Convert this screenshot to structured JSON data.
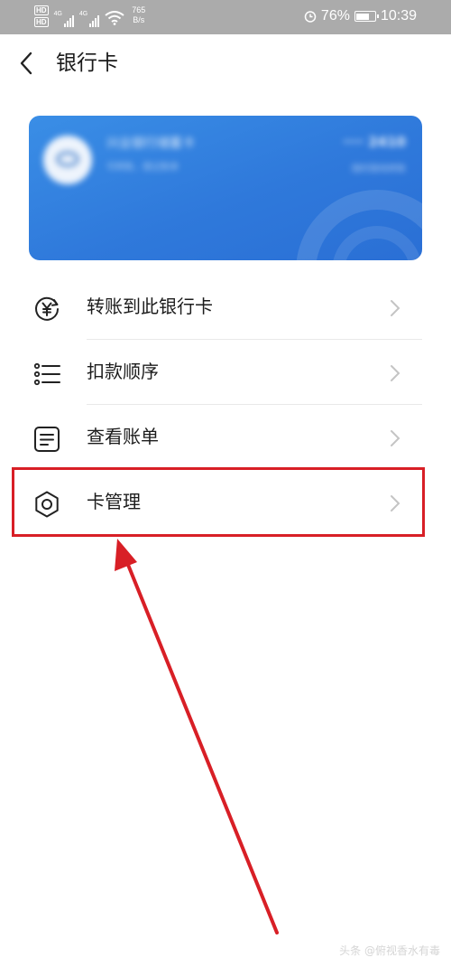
{
  "status_bar": {
    "hd1": "HD",
    "hd2": "HD",
    "net1": "4G",
    "net2": "4G",
    "speed_value": "765",
    "speed_unit": "B/s",
    "battery": "76%",
    "battery_level": 0.76,
    "time": "10:39"
  },
  "header": {
    "title": "银行卡"
  },
  "card": {
    "bank_name": "兴业银行储蓄卡",
    "sub_text": "可转账，借记账单",
    "number": "···· 2410",
    "status": "随时随地转账"
  },
  "menu": {
    "items": [
      {
        "label": "转账到此银行卡",
        "icon": "yuan-transfer-icon"
      },
      {
        "label": "扣款顺序",
        "icon": "list-icon"
      },
      {
        "label": "查看账单",
        "icon": "bill-icon"
      },
      {
        "label": "卡管理",
        "icon": "gear-icon"
      }
    ]
  },
  "annotation": {
    "highlight_color": "#d81f26"
  },
  "watermark": "头条 @俯视香水有毒"
}
